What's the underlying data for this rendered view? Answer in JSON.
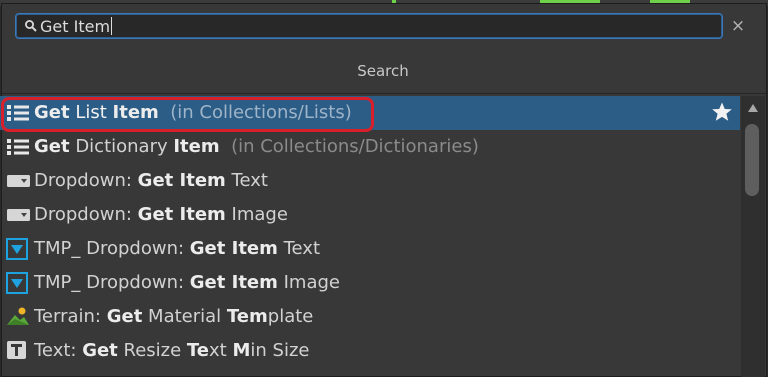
{
  "search": {
    "query": "Get Item",
    "close_glyph": "×"
  },
  "section_title": "Search",
  "results": [
    {
      "icon": "list-icon",
      "parts": [
        {
          "t": "Get",
          "b": true
        },
        {
          "t": " List ",
          "b": false
        },
        {
          "t": "Item",
          "b": true
        }
      ],
      "context": "  (in Collections/Lists)",
      "selected": true
    },
    {
      "icon": "list-icon",
      "parts": [
        {
          "t": "Get",
          "b": true
        },
        {
          "t": " Dictionary ",
          "b": false
        },
        {
          "t": "Item",
          "b": true
        }
      ],
      "context": "  (in Collections/Dictionaries)",
      "selected": false
    },
    {
      "icon": "dropdown-icon",
      "parts": [
        {
          "t": "Dropdown: ",
          "b": false
        },
        {
          "t": "Get Item",
          "b": true
        },
        {
          "t": " Text",
          "b": false
        }
      ],
      "context": "",
      "selected": false
    },
    {
      "icon": "dropdown-icon",
      "parts": [
        {
          "t": "Dropdown: ",
          "b": false
        },
        {
          "t": "Get Item",
          "b": true
        },
        {
          "t": " Image",
          "b": false
        }
      ],
      "context": "",
      "selected": false
    },
    {
      "icon": "tmp-dropdown-icon",
      "parts": [
        {
          "t": "TMP_ Dropdown: ",
          "b": false
        },
        {
          "t": "Get Item",
          "b": true
        },
        {
          "t": " Text",
          "b": false
        }
      ],
      "context": "",
      "selected": false
    },
    {
      "icon": "tmp-dropdown-icon",
      "parts": [
        {
          "t": "TMP_ Dropdown: ",
          "b": false
        },
        {
          "t": "Get Item",
          "b": true
        },
        {
          "t": " Image",
          "b": false
        }
      ],
      "context": "",
      "selected": false
    },
    {
      "icon": "terrain-icon",
      "parts": [
        {
          "t": "Terrain: ",
          "b": false
        },
        {
          "t": "Get",
          "b": true
        },
        {
          "t": " Material ",
          "b": false
        },
        {
          "t": "Tem",
          "b": true
        },
        {
          "t": "plate",
          "b": false
        }
      ],
      "context": "",
      "selected": false
    },
    {
      "icon": "text-icon",
      "parts": [
        {
          "t": "Text: ",
          "b": false
        },
        {
          "t": "Get",
          "b": true
        },
        {
          "t": " Resize ",
          "b": false
        },
        {
          "t": "Te",
          "b": true
        },
        {
          "t": "xt ",
          "b": false
        },
        {
          "t": "M",
          "b": true
        },
        {
          "t": "in Size",
          "b": false
        }
      ],
      "context": "",
      "selected": false
    }
  ],
  "colors": {
    "selected_bg": "#2c5d87",
    "highlight_border": "#d9202a",
    "search_border": "#3a79bb",
    "tmp_icon_blue": "#1fa2e0"
  }
}
